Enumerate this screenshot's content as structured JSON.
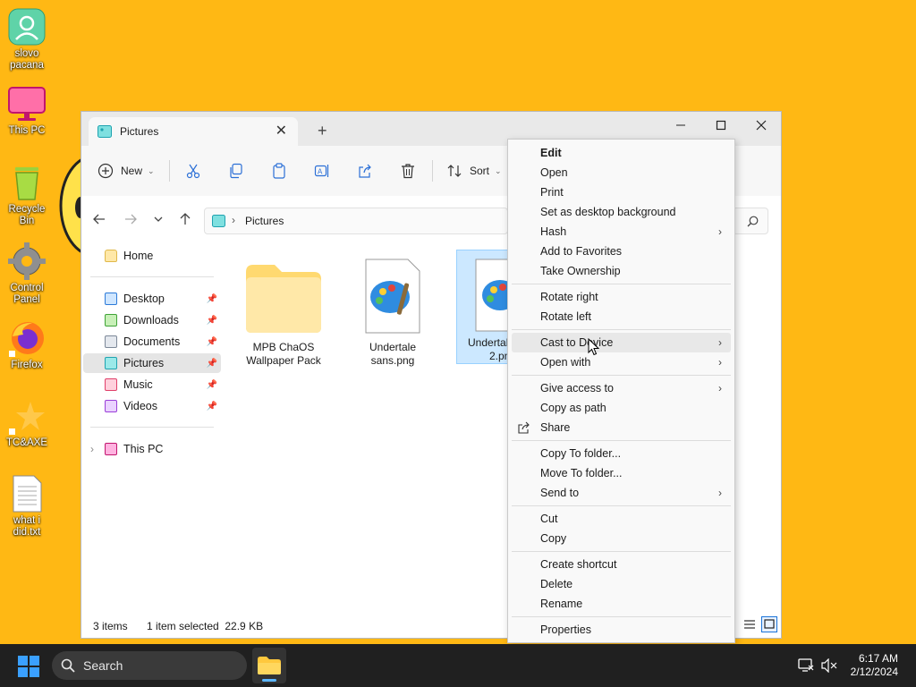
{
  "desktop": {
    "icons": [
      {
        "label_1": "slovo",
        "label_2": "pacana"
      },
      {
        "label_1": "This PC"
      },
      {
        "label_1": "Recycle",
        "label_2": "Bin"
      },
      {
        "label_1": "Control",
        "label_2": "Panel"
      },
      {
        "label_1": "Firefox"
      },
      {
        "label_1": "TC&AXE"
      },
      {
        "label_1": "what i",
        "label_2": "did.txt"
      }
    ]
  },
  "explorer": {
    "tab_title": "Pictures",
    "toolbar": {
      "new_label": "New",
      "sort_label": "Sort"
    },
    "address": {
      "segment": "Pictures"
    },
    "nav": {
      "home": "Home",
      "items": [
        "Desktop",
        "Downloads",
        "Documents",
        "Pictures",
        "Music",
        "Videos"
      ],
      "this_pc": "This PC"
    },
    "files": [
      {
        "line1": "MPB ChaOS",
        "line2": "Wallpaper Pack"
      },
      {
        "line1": "Undertale",
        "line2": "sans.png"
      },
      {
        "line1": "Undertal",
        "line2": "2.pn"
      }
    ],
    "status": {
      "count": "3 items",
      "selection": "1 item selected  22.9 KB"
    }
  },
  "context_menu": {
    "items": [
      "Edit",
      "Open",
      "Print",
      "Set as desktop background",
      "Hash",
      "Add to Favorites",
      "Take Ownership",
      "Rotate right",
      "Rotate left",
      "Cast to Device",
      "Open with",
      "Give access to",
      "Copy as path",
      "Share",
      "Copy To folder...",
      "Move To folder...",
      "Send to",
      "Cut",
      "Copy",
      "Create shortcut",
      "Delete",
      "Rename",
      "Properties"
    ]
  },
  "taskbar": {
    "search_placeholder": "Search",
    "time": "6:17 AM",
    "date": "2/12/2024"
  },
  "colors": {
    "desktop_bg": "#FFB814",
    "selection": "#CCE8FF",
    "taskbar": "#202020"
  }
}
